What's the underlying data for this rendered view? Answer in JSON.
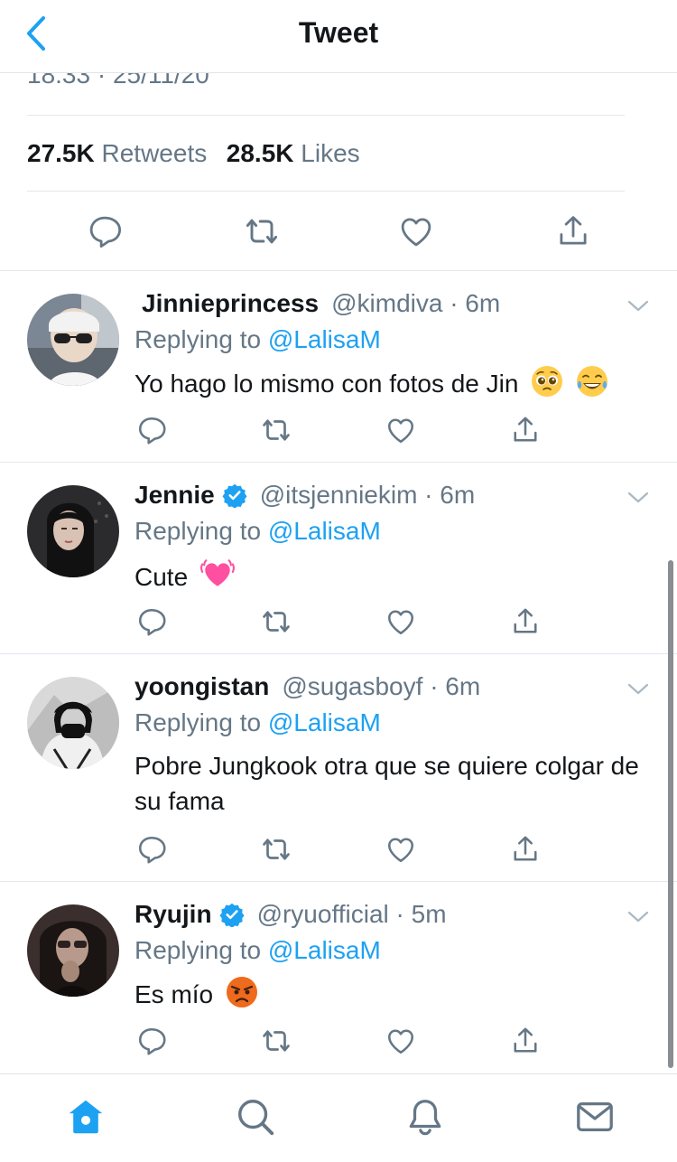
{
  "header": {
    "title": "Tweet"
  },
  "tweet": {
    "timestamp": "18:33 · 25/11/20",
    "retweets_count": "27.5K",
    "retweets_label": "Retweets",
    "likes_count": "28.5K",
    "likes_label": "Likes"
  },
  "replies": [
    {
      "name": "Jinnieprincess",
      "verified": false,
      "handle_time": "@kimdiva · 6m",
      "replying_prefix": "Replying to",
      "replying_to": "@LalisaM",
      "text": "Yo hago lo mismo con fotos de Jin",
      "emojis": [
        "pleading-face",
        "tears-of-joy"
      ]
    },
    {
      "name": "Jennie",
      "verified": true,
      "handle_time": "@itsjenniekim · 6m",
      "replying_prefix": "Replying to",
      "replying_to": "@LalisaM",
      "text": "Cute",
      "emojis": [
        "beating-heart"
      ]
    },
    {
      "name": "yoongistan",
      "verified": false,
      "handle_time": "@sugasboyf · 6m",
      "replying_prefix": "Replying to",
      "replying_to": "@LalisaM",
      "text": "Pobre Jungkook otra que se quiere colgar de su fama",
      "emojis": []
    },
    {
      "name": "Ryujin",
      "verified": true,
      "handle_time": "@ryuofficial · 5m",
      "replying_prefix": "Replying to",
      "replying_to": "@LalisaM",
      "text": "Es mío",
      "emojis": [
        "angry-face"
      ]
    }
  ],
  "tabbar": {
    "items": [
      "home-icon",
      "search-icon",
      "notifications-icon",
      "messages-icon"
    ]
  },
  "colors": {
    "accent": "#1da1f2",
    "muted": "#657786",
    "text": "#14171a",
    "divider": "#e1e8ed"
  }
}
